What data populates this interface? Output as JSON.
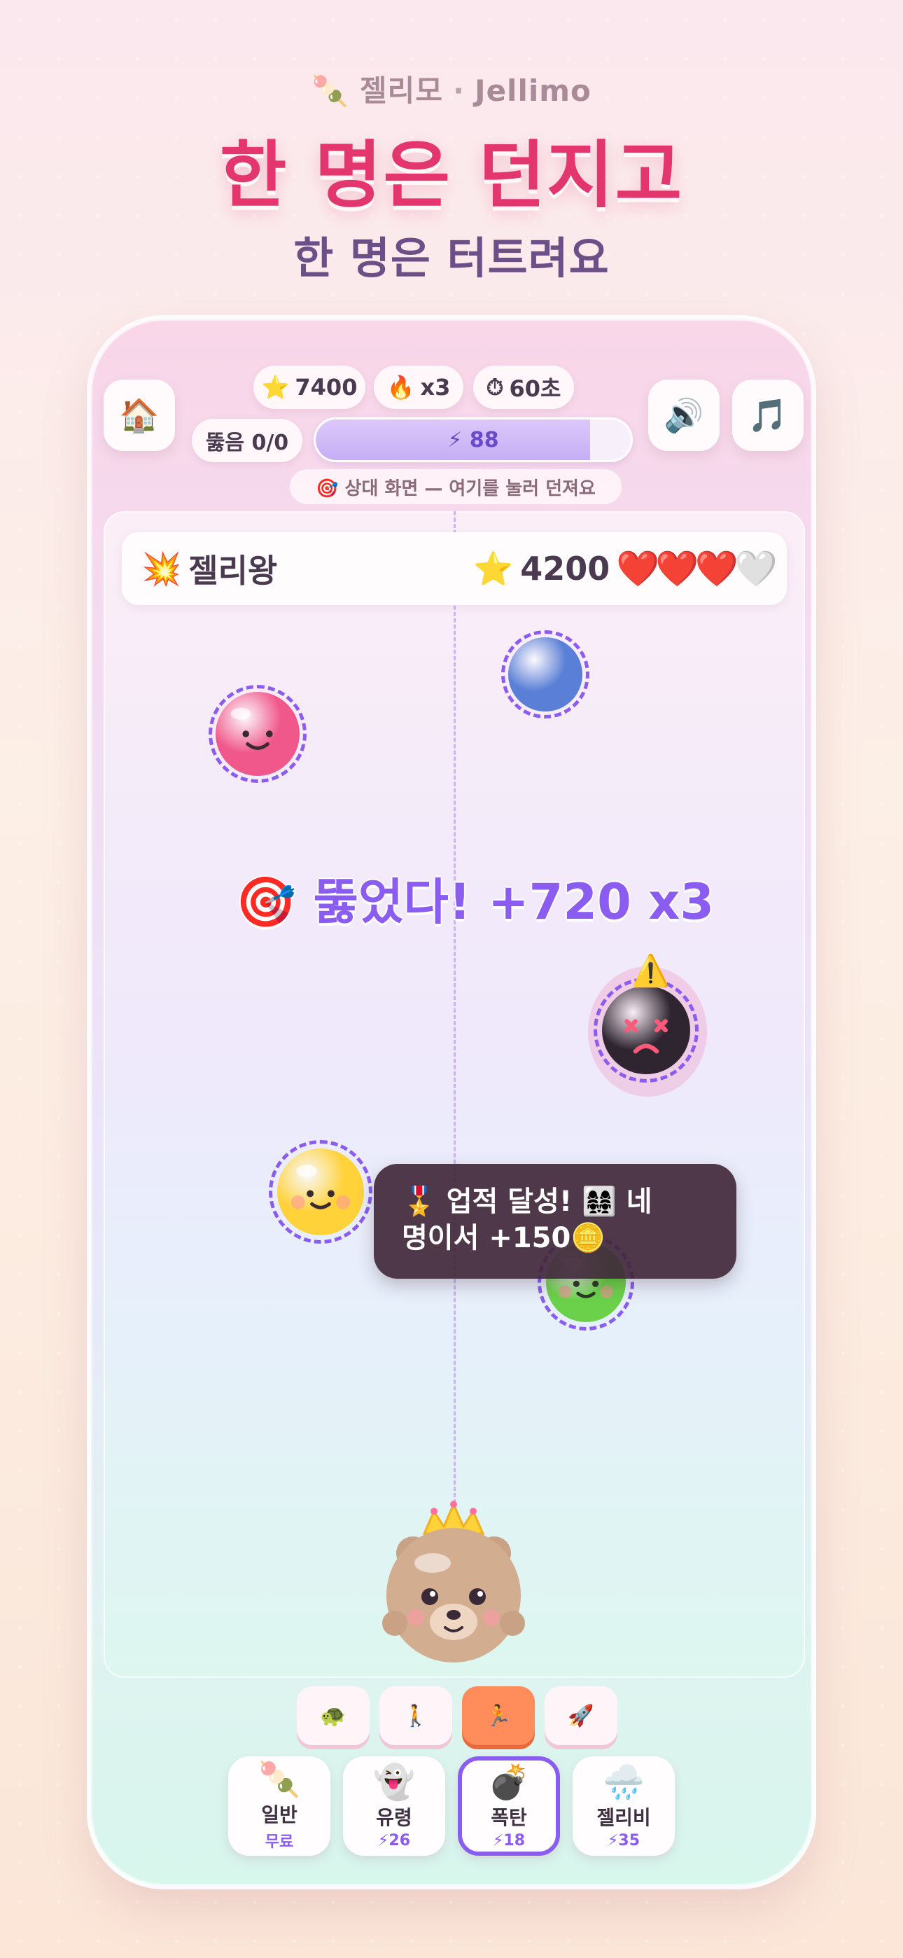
{
  "brand": {
    "icon": "dango-icon",
    "name": "젤리모",
    "separator": "·",
    "name_en": "Jellimo"
  },
  "headline": "한 명은 던지고",
  "subheadline": "한 명은 터트려요",
  "hud": {
    "home_icon": "🏠",
    "score": "7400",
    "score_icon": "⭐",
    "combo": "x3",
    "combo_icon": "🔥",
    "timer": "60초",
    "timer_icon": "⏱",
    "pierce": "뚫음 0/0",
    "energy": "88",
    "energy_icon": "⚡",
    "energy_level": 0.87,
    "sound_icon": "🔊",
    "music_icon": "🎵",
    "hint": "🎯 상대 화면 — 여기를 눌러 던져요"
  },
  "opponent": {
    "icon": "💥",
    "name": "젤리왕",
    "score_icon": "⭐",
    "score": "4200",
    "hearts": [
      "❤️",
      "❤️",
      "❤️",
      "🤍"
    ]
  },
  "toast": {
    "line1": "🎖️ 업적 달성! 👩‍👩‍👧‍👧 네",
    "line2": "명이서 +150🪙"
  },
  "popup": "🎯 뚫었다! +720  x3",
  "jellies": [
    {
      "name": "pink-jelly",
      "color": "#f0578a"
    },
    {
      "name": "blue-jelly",
      "color": "#5a7fd6"
    },
    {
      "name": "bomb-jelly",
      "color": "#2f2530",
      "warning": "⚠️"
    },
    {
      "name": "yellow-jelly",
      "color": "#ffd23a"
    },
    {
      "name": "green-jelly",
      "color": "#6bd14a"
    }
  ],
  "speeds": [
    {
      "icon": "🐢",
      "selected": false
    },
    {
      "icon": "🚶",
      "selected": false
    },
    {
      "icon": "🏃",
      "selected": true
    },
    {
      "icon": "🚀",
      "selected": false
    }
  ],
  "ammo": [
    {
      "icon": "🍡",
      "name": "일반",
      "cost": "무료",
      "selected": false
    },
    {
      "icon": "👻",
      "name": "유령",
      "cost": "⚡26",
      "selected": false
    },
    {
      "icon": "💣",
      "name": "폭탄",
      "cost": "⚡18",
      "selected": true
    },
    {
      "icon": "🌧️",
      "name": "젤리비",
      "cost": "⚡35",
      "selected": false
    }
  ],
  "colors": {
    "accent": "#8a5cf0",
    "headline": "#e3366f",
    "subheadline": "#6b4f86"
  }
}
